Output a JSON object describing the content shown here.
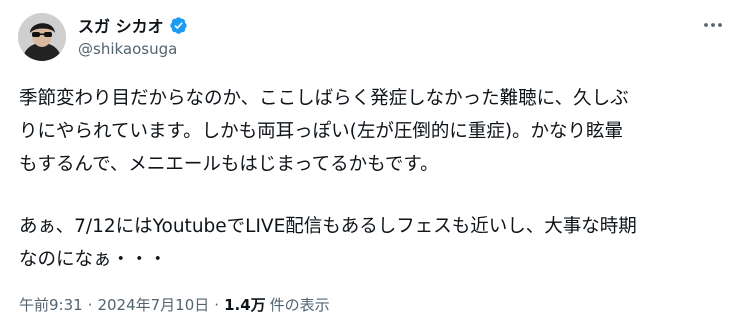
{
  "author": {
    "display_name": "スガ シカオ",
    "handle": "@shikaosuga",
    "verified_icon": "verified-badge-icon",
    "badge_color": "#1d9bf0"
  },
  "post": {
    "lines_p1": [
      "季節変わり目だからなのか、ここしばらく発症しなかった難聴に、久しぶ",
      "りにやられています。しかも両耳っぽい(左が圧倒的に重症)。かなり眩暈",
      "もするんで、メニエールもはじまってるかもです。"
    ],
    "lines_p2": [
      "あぁ、7/12にはYoutubeでLIVE配信もあるしフェスも近いし、大事な時期",
      "なのになぁ・・・"
    ]
  },
  "meta": {
    "time": "午前9:31",
    "separator": "·",
    "date": "2024年7月10日",
    "views_count": "1.4万",
    "views_label": "件の表示"
  },
  "menu": {
    "more_icon": "more-options-icon"
  },
  "colors": {
    "text": "#0f1419",
    "secondary": "#536471",
    "accent": "#1d9bf0"
  }
}
